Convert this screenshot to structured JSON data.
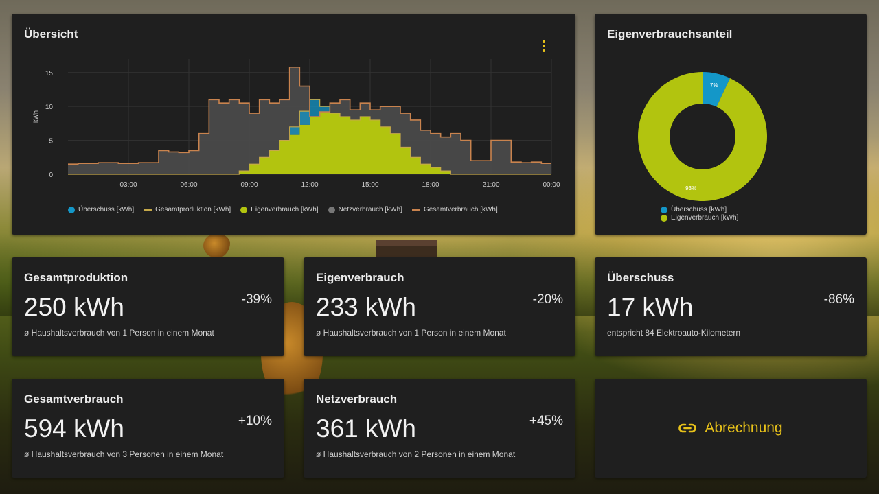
{
  "colors": {
    "surplus": "#1497c8",
    "production": "#c6a94a",
    "self_consumption": "#b2c40f",
    "grid": "#4a4a4a",
    "total_consumption": "#c9834e",
    "accent": "#e8c21a"
  },
  "overview": {
    "title": "Übersicht",
    "menu_icon": "more-vert-icon"
  },
  "share": {
    "title": "Eigenverbrauchsanteil"
  },
  "links": {
    "billing_label": "Abrechnung",
    "billing_icon": "link-icon"
  },
  "stats": [
    {
      "title": "Gesamtproduktion",
      "value": "250 kWh",
      "change": "-39%",
      "desc": "ø Haushaltsverbrauch von 1 Person in einem Monat"
    },
    {
      "title": "Eigenverbrauch",
      "value": "233 kWh",
      "change": "-20%",
      "desc": "ø Haushaltsverbrauch von 1 Person in einem Monat"
    },
    {
      "title": "Überschuss",
      "value": "17 kWh",
      "change": "-86%",
      "desc": "entspricht 84 Elektroauto-Kilometern"
    },
    {
      "title": "Gesamtverbrauch",
      "value": "594 kWh",
      "change": "+10%",
      "desc": "ø Haushaltsverbrauch von 3 Personen in einem Monat"
    },
    {
      "title": "Netzverbrauch",
      "value": "361 kWh",
      "change": "+45%",
      "desc": "ø Haushaltsverbrauch von 2 Personen in einem Monat"
    }
  ],
  "chart_data": [
    {
      "type": "area",
      "title": "Übersicht",
      "xlabel": "",
      "ylabel": "kWh",
      "ylim": [
        0,
        17
      ],
      "yticks": [
        "0",
        "5",
        "10",
        "15"
      ],
      "xticks": [
        "03:00",
        "06:00",
        "09:00",
        "12:00",
        "15:00",
        "18:00",
        "21:00",
        "00:00"
      ],
      "xtick_hours": [
        3,
        6,
        9,
        12,
        15,
        18,
        21,
        24
      ],
      "xlim_hours": [
        0,
        24
      ],
      "grid": true,
      "legend_position": "bottom",
      "x_hours": [
        0.25,
        0.75,
        1.25,
        1.75,
        2.25,
        2.75,
        3.25,
        3.75,
        4.25,
        4.75,
        5.25,
        5.75,
        6.25,
        6.75,
        7.25,
        7.75,
        8.25,
        8.75,
        9.25,
        9.75,
        10.25,
        10.75,
        11.25,
        11.75,
        12.25,
        12.75,
        13.25,
        13.75,
        14.25,
        14.75,
        15.25,
        15.75,
        16.25,
        16.75,
        17.25,
        17.75,
        18.25,
        18.75,
        19.25,
        19.75,
        20.25,
        20.75,
        21.25,
        21.75,
        22.25,
        22.75,
        23.25,
        23.75
      ],
      "series": [
        {
          "name": "Überschuss [kWh]",
          "legend_shape": "dot",
          "values": [
            0,
            0,
            0,
            0,
            0,
            0,
            0,
            0,
            0,
            0,
            0,
            0,
            0,
            0,
            0,
            0,
            0,
            0,
            0,
            0,
            0,
            0,
            1.2,
            2.0,
            2.5,
            0.8,
            0,
            0,
            0,
            0,
            0,
            0,
            0,
            0,
            0,
            0,
            0,
            0,
            0,
            0,
            0,
            0,
            0,
            0,
            0,
            0,
            0,
            0
          ]
        },
        {
          "name": "Gesamtproduktion [kWh]",
          "legend_shape": "line",
          "values": [
            0,
            0,
            0,
            0,
            0,
            0,
            0,
            0,
            0,
            0,
            0,
            0,
            0,
            0,
            0,
            0,
            0,
            0.5,
            1.5,
            2.5,
            3.5,
            5.0,
            7.0,
            9.3,
            11.0,
            10.0,
            9.0,
            8.5,
            8.0,
            8.5,
            8.0,
            7.0,
            6.0,
            4.0,
            2.5,
            1.5,
            1.0,
            0.5,
            0,
            0,
            0,
            0,
            0,
            0,
            0,
            0,
            0,
            0
          ]
        },
        {
          "name": "Eigenverbrauch [kWh]",
          "legend_shape": "dot",
          "values": [
            0,
            0,
            0,
            0,
            0,
            0,
            0,
            0,
            0,
            0,
            0,
            0,
            0,
            0,
            0,
            0,
            0,
            0.5,
            1.5,
            2.5,
            3.5,
            5.0,
            5.8,
            7.3,
            8.5,
            9.2,
            9.0,
            8.5,
            8.0,
            8.5,
            8.0,
            7.0,
            6.0,
            4.0,
            2.5,
            1.5,
            1.0,
            0.5,
            0,
            0,
            0,
            0,
            0,
            0,
            0,
            0,
            0,
            0
          ]
        },
        {
          "name": "Netzverbrauch [kWh]",
          "legend_shape": "dot",
          "values": [
            1.5,
            1.6,
            1.6,
            1.7,
            1.7,
            1.6,
            1.6,
            1.7,
            1.7,
            3.5,
            3.3,
            3.2,
            3.5,
            6.0,
            11.0,
            10.5,
            11.0,
            10.0,
            7.5,
            8.5,
            7.0,
            6.0,
            10.0,
            5.7,
            0,
            0,
            1.5,
            2.5,
            1.5,
            2.0,
            1.5,
            3.0,
            4.0,
            5.0,
            5.5,
            5.0,
            5.0,
            5.0,
            6.0,
            5.0,
            2.0,
            2.0,
            5.0,
            5.0,
            1.8,
            1.7,
            1.8,
            1.6
          ]
        },
        {
          "name": "Gesamtverbrauch [kWh]",
          "legend_shape": "line",
          "values": [
            1.5,
            1.6,
            1.6,
            1.7,
            1.7,
            1.6,
            1.6,
            1.7,
            1.7,
            3.5,
            3.3,
            3.2,
            3.5,
            6.0,
            11.0,
            10.5,
            11.0,
            10.5,
            9.0,
            11.0,
            10.5,
            11.0,
            15.8,
            13.0,
            8.5,
            9.2,
            10.5,
            11.0,
            9.5,
            10.5,
            9.5,
            10.0,
            10.0,
            9.0,
            8.0,
            6.5,
            6.0,
            5.5,
            6.0,
            5.0,
            2.0,
            2.0,
            5.0,
            5.0,
            1.8,
            1.7,
            1.8,
            1.6
          ]
        }
      ]
    },
    {
      "type": "pie",
      "title": "Eigenverbrauchsanteil",
      "donut": true,
      "legend_position": "bottom",
      "series": [
        {
          "name": "Überschuss [kWh]",
          "value": 7,
          "label": "7%"
        },
        {
          "name": "Eigenverbrauch [kWh]",
          "value": 93,
          "label": "93%"
        }
      ]
    }
  ]
}
